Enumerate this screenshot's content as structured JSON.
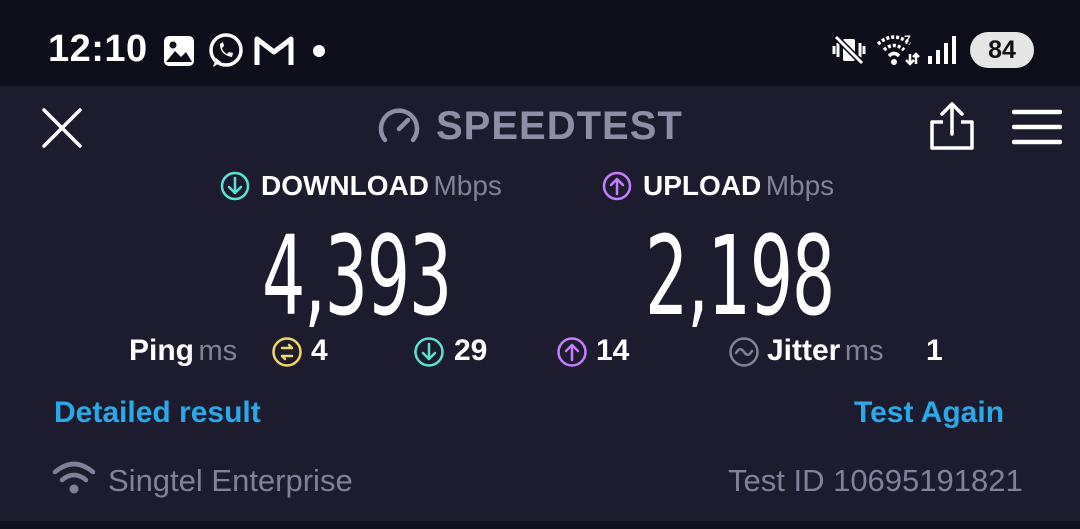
{
  "status_bar": {
    "time": "12:10",
    "battery": "84",
    "icons": [
      "image-icon",
      "whatsapp-icon",
      "gmail-icon",
      "dot-icon",
      "vibrate-mute-icon",
      "wifi-icon",
      "signal-icon"
    ]
  },
  "header": {
    "title": "SPEEDTEST",
    "close_icon": "close-icon",
    "share_icon": "share-icon",
    "menu_icon": "menu-icon"
  },
  "download": {
    "label": "DOWNLOAD",
    "unit": "Mbps",
    "value": "4,393",
    "color": "#5ce1d2"
  },
  "upload": {
    "label": "UPLOAD",
    "unit": "Mbps",
    "value": "2,198",
    "color": "#c77dff"
  },
  "stats": {
    "ping_label": "Ping",
    "ping_unit": "ms",
    "ping_idle": "4",
    "ping_download": "29",
    "ping_upload": "14",
    "jitter_label": "Jitter",
    "jitter_unit": "ms",
    "jitter": "1",
    "idle_color": "#f3d75c"
  },
  "actions": {
    "detailed": "Detailed result",
    "again": "Test Again"
  },
  "footer": {
    "provider": "Singtel Enterprise",
    "test_id": "Test ID 10695191821"
  }
}
